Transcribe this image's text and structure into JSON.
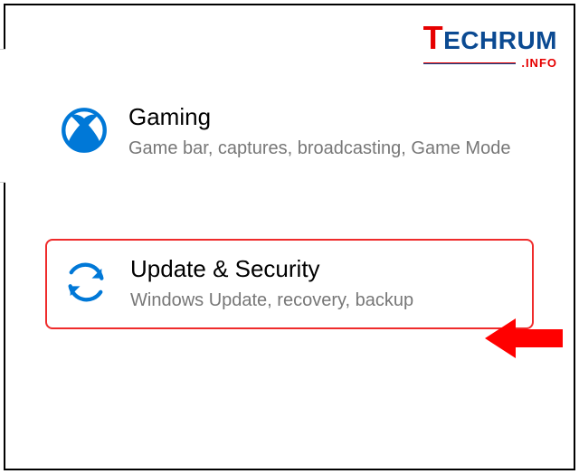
{
  "watermark": {
    "brand_t": "T",
    "brand_rest": "ECHRUM",
    "sub": ".INFO"
  },
  "settings": {
    "items": [
      {
        "title": "Gaming",
        "description": "Game bar, captures, broadcasting, Game Mode"
      },
      {
        "title": "Update & Security",
        "description": "Windows Update, recovery, backup"
      }
    ]
  },
  "colors": {
    "accent_blue": "#0078d7",
    "highlight_red": "#ef2b2b",
    "arrow_red": "#ff0000"
  }
}
